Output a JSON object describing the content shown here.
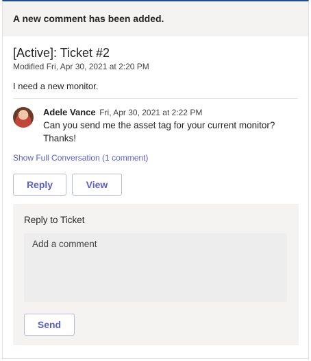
{
  "banner": {
    "text": "A new comment has been added."
  },
  "ticket": {
    "title": "[Active]: Ticket #2",
    "modified": "Modified Fri, Apr 30, 2021 at 2:20 PM",
    "description": "I need a new monitor."
  },
  "comment": {
    "author": "Adele Vance",
    "timestamp": "Fri, Apr 30, 2021 at 2:22 PM",
    "text": "Can you send me the asset tag for your current monitor? Thanks!",
    "avatar_icon": "user-avatar-photo"
  },
  "show_conversation": {
    "label": "Show Full Conversation (1 comment)"
  },
  "actions": {
    "reply_label": "Reply",
    "view_label": "View"
  },
  "reply_panel": {
    "title": "Reply to Ticket",
    "placeholder": "Add a comment",
    "value": "",
    "send_label": "Send"
  },
  "colors": {
    "accent": "#5b5fc7",
    "top_border": "#1e4e8c",
    "banner_bg": "#f5f3f1"
  }
}
